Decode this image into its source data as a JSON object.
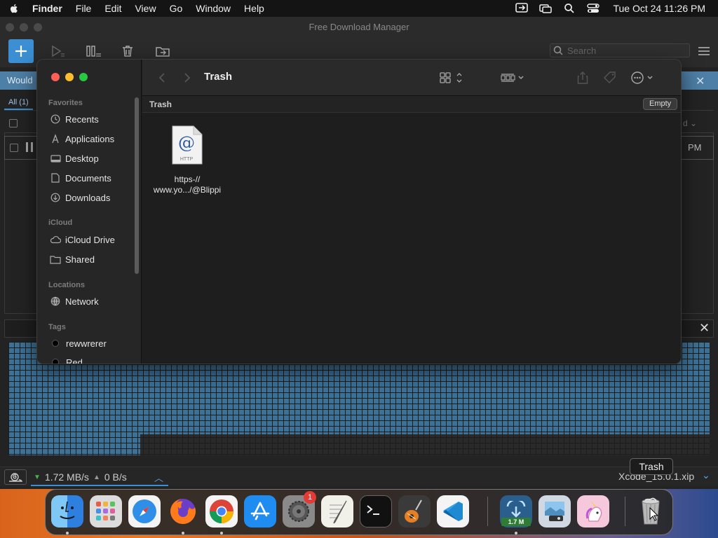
{
  "menubar": {
    "app_name": "Finder",
    "items": [
      "File",
      "Edit",
      "View",
      "Go",
      "Window",
      "Help"
    ],
    "clock": "Tue Oct 24  11:26 PM",
    "status_icons": [
      "screen-mirroring-icon",
      "display-icon",
      "spotlight-icon",
      "control-center-icon"
    ]
  },
  "fdm": {
    "window_title": "Free Download Manager",
    "search_placeholder": "Search",
    "banner_text": "Would",
    "tab_all": "All (1)",
    "row_time": "PM",
    "sort_fragment": "d",
    "status": {
      "download_speed": "1.72 MB/s",
      "upload_speed": "0 B/s",
      "download_name": "Xcode_15.0.1.xip"
    },
    "colors": {
      "accent": "#3b8fd2",
      "banner": "#4e7fa6"
    }
  },
  "finder": {
    "title": "Trash",
    "path_label": "Trash",
    "empty_button": "Empty",
    "sidebar": {
      "favorites_header": "Favorites",
      "favorites": [
        {
          "label": "Recents",
          "icon": "clock-icon"
        },
        {
          "label": "Applications",
          "icon": "applications-icon"
        },
        {
          "label": "Desktop",
          "icon": "desktop-icon"
        },
        {
          "label": "Documents",
          "icon": "document-icon"
        },
        {
          "label": "Downloads",
          "icon": "download-icon"
        }
      ],
      "icloud_header": "iCloud",
      "icloud": [
        {
          "label": "iCloud Drive",
          "icon": "cloud-icon"
        },
        {
          "label": "Shared",
          "icon": "shared-folder-icon"
        }
      ],
      "locations_header": "Locations",
      "locations": [
        {
          "label": "Network",
          "icon": "globe-icon"
        }
      ],
      "tags_header": "Tags",
      "tags": [
        {
          "label": "rewwrerer",
          "color": "#000000"
        },
        {
          "label": "Red",
          "color": "#000000"
        }
      ]
    },
    "file": {
      "icon_label": "HTTP",
      "name_line1": "https-//",
      "name_line2": "www.yo.../@Blippi"
    }
  },
  "tooltip": "Trash",
  "dock": {
    "apps": [
      "finder-icon",
      "launchpad-icon",
      "safari-icon",
      "firefox-icon",
      "chrome-icon",
      "app-store-icon",
      "system-settings-icon",
      "textedit-icon",
      "terminal-icon",
      "garageband-icon",
      "vscode-icon",
      "free-download-manager-icon",
      "preview-icon",
      "unicorn-app-icon",
      "trash-icon"
    ],
    "settings_badge": "1",
    "fdm_speed_tag": "1.7 M"
  }
}
